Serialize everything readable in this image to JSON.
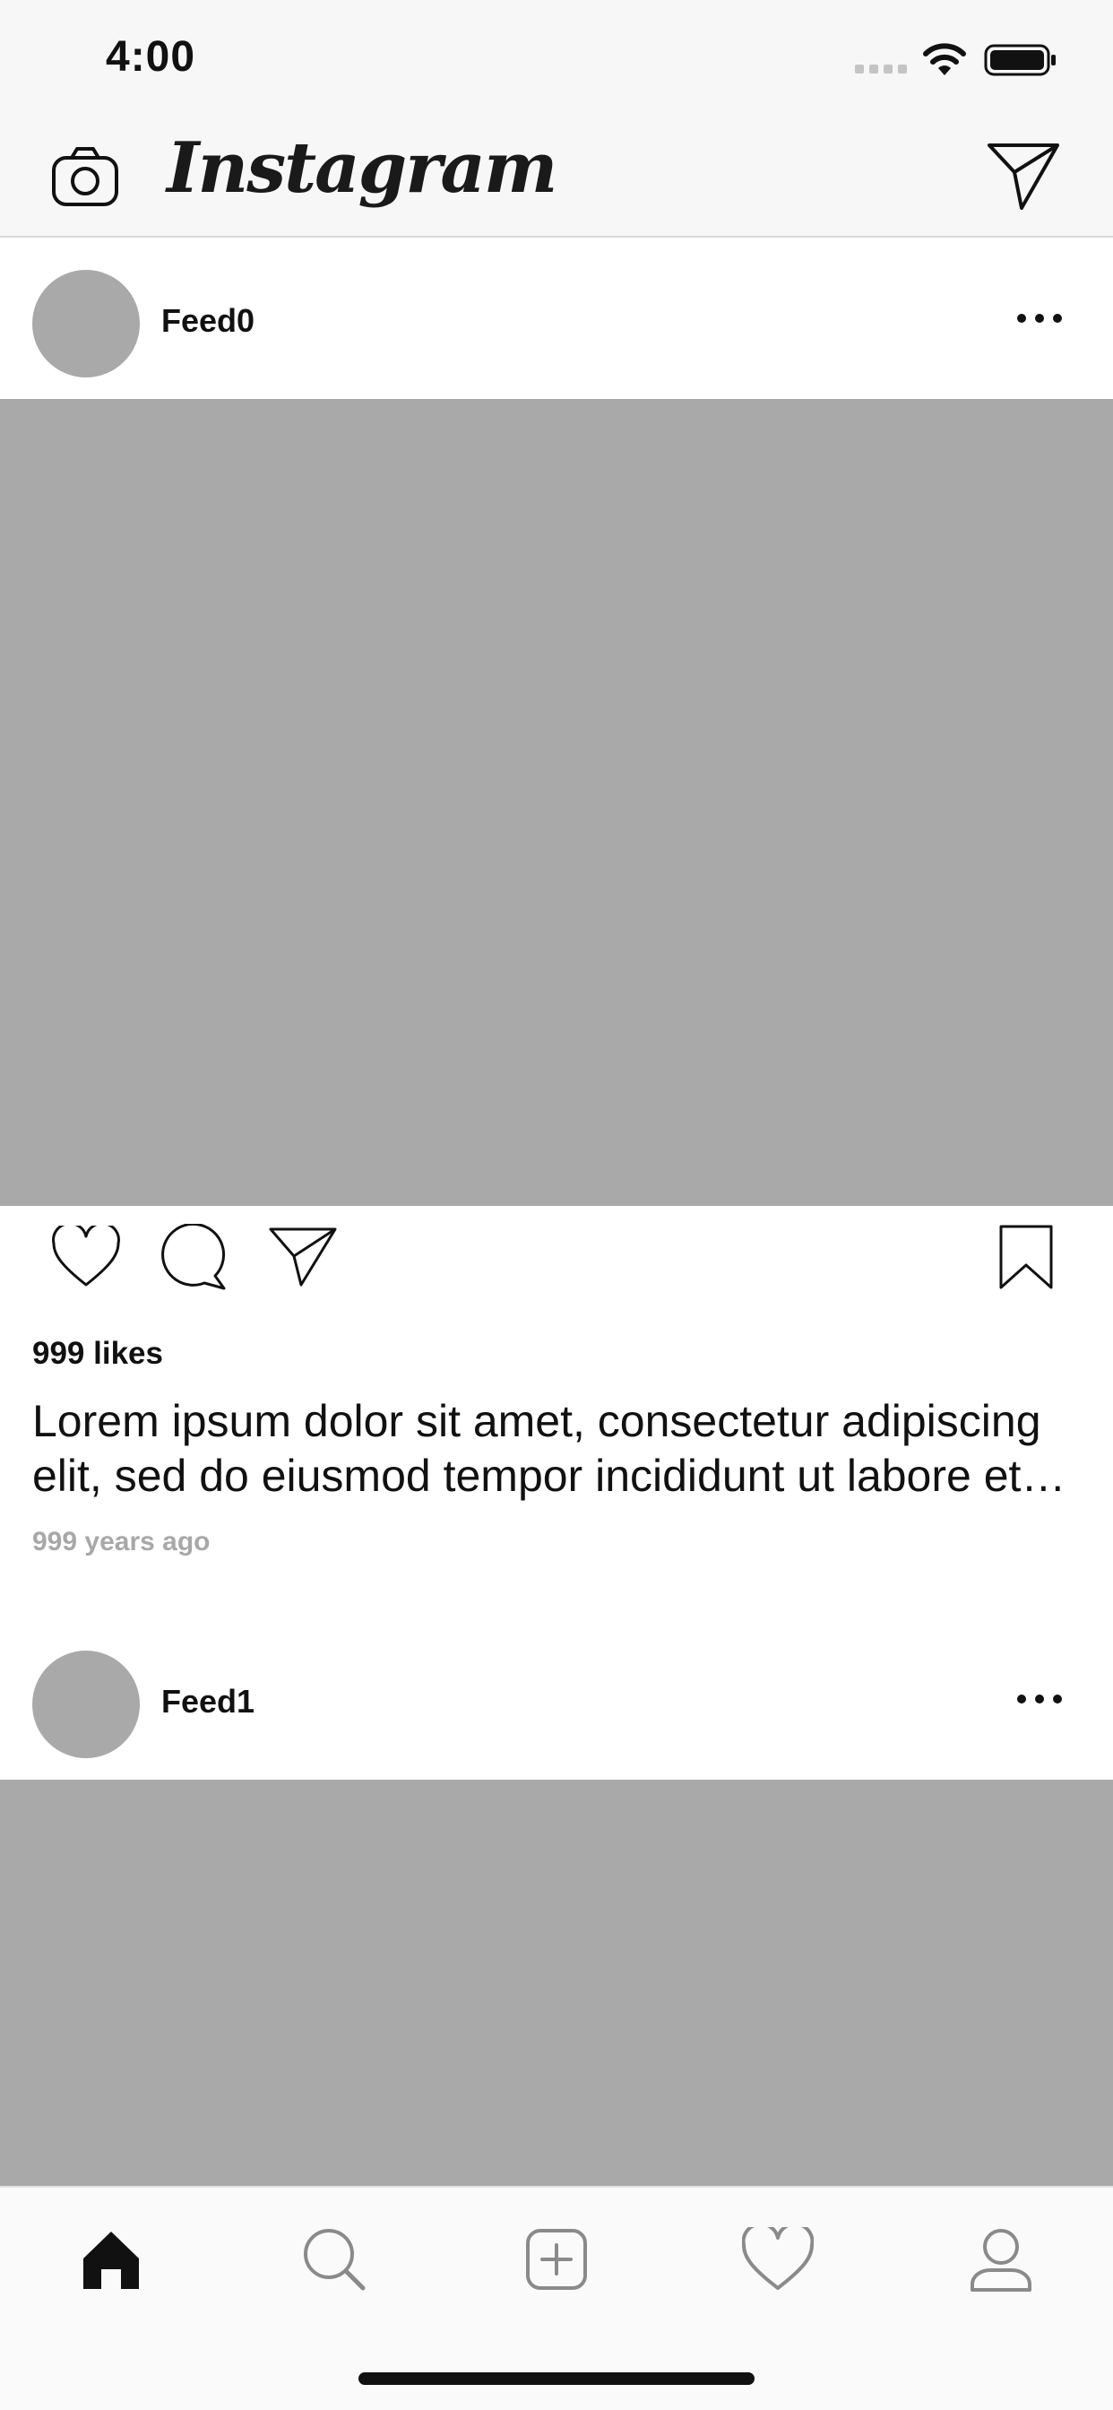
{
  "status_bar": {
    "time": "4:00",
    "icons": [
      "cellular-signal-icon",
      "wifi-icon",
      "battery-icon"
    ]
  },
  "nav_bar": {
    "logo": "Instagram",
    "icons": [
      "camera-icon",
      "direct-message-icon"
    ]
  },
  "feed": [
    {
      "username": "Feed0",
      "likes": "999 likes",
      "caption": "Lorem ipsum dolor sit amet, consectetur adipiscing elit, sed do eiusmod tempor incididunt ut labore et dolore magna aliqua.",
      "time_ago": "999 years ago"
    },
    {
      "username": "Feed1"
    }
  ],
  "post_actions": [
    "heart-icon",
    "comment-icon",
    "share-icon",
    "bookmark-icon"
  ],
  "tab_bar": {
    "tabs": [
      "home-icon",
      "search-icon",
      "add-post-icon",
      "activity-heart-icon",
      "profile-icon"
    ],
    "active": "home-icon"
  },
  "colors": {
    "placeholder_gray": "#a9a9a9",
    "bar_background": "#f7f7f7",
    "secondary_text": "#a8a8a8",
    "primary_text": "#111111"
  }
}
